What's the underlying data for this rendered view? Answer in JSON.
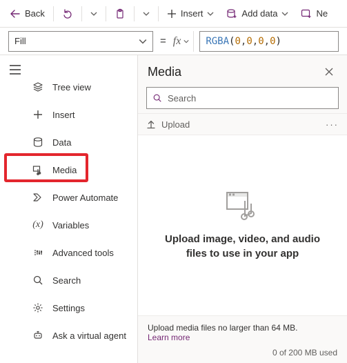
{
  "cmdbar": {
    "back": "Back",
    "insert": "Insert",
    "add_data": "Add data",
    "new_truncated": "Ne"
  },
  "formula": {
    "property": "Fill",
    "fx_label": "fx",
    "expr_fn": "RGBA",
    "expr_open": "(",
    "n0": "0",
    "n1": "0",
    "n2": "0",
    "n3": "0",
    "comma": ", ",
    "expr_close": ")"
  },
  "nav": {
    "items": [
      {
        "label": "Tree view"
      },
      {
        "label": "Insert"
      },
      {
        "label": "Data"
      },
      {
        "label": "Media"
      },
      {
        "label": "Power Automate"
      },
      {
        "label": "Variables"
      },
      {
        "label": "Advanced tools"
      },
      {
        "label": "Search"
      },
      {
        "label": "Settings"
      },
      {
        "label": "Ask a virtual agent"
      }
    ]
  },
  "pane": {
    "title": "Media",
    "search_placeholder": "Search",
    "upload": "Upload",
    "empty_text": "Upload image, video, and audio files to use in your app",
    "footer_text": "Upload media files no larger than 64 MB.",
    "learn_more": "Learn more",
    "usage": "0 of 200 MB used"
  }
}
